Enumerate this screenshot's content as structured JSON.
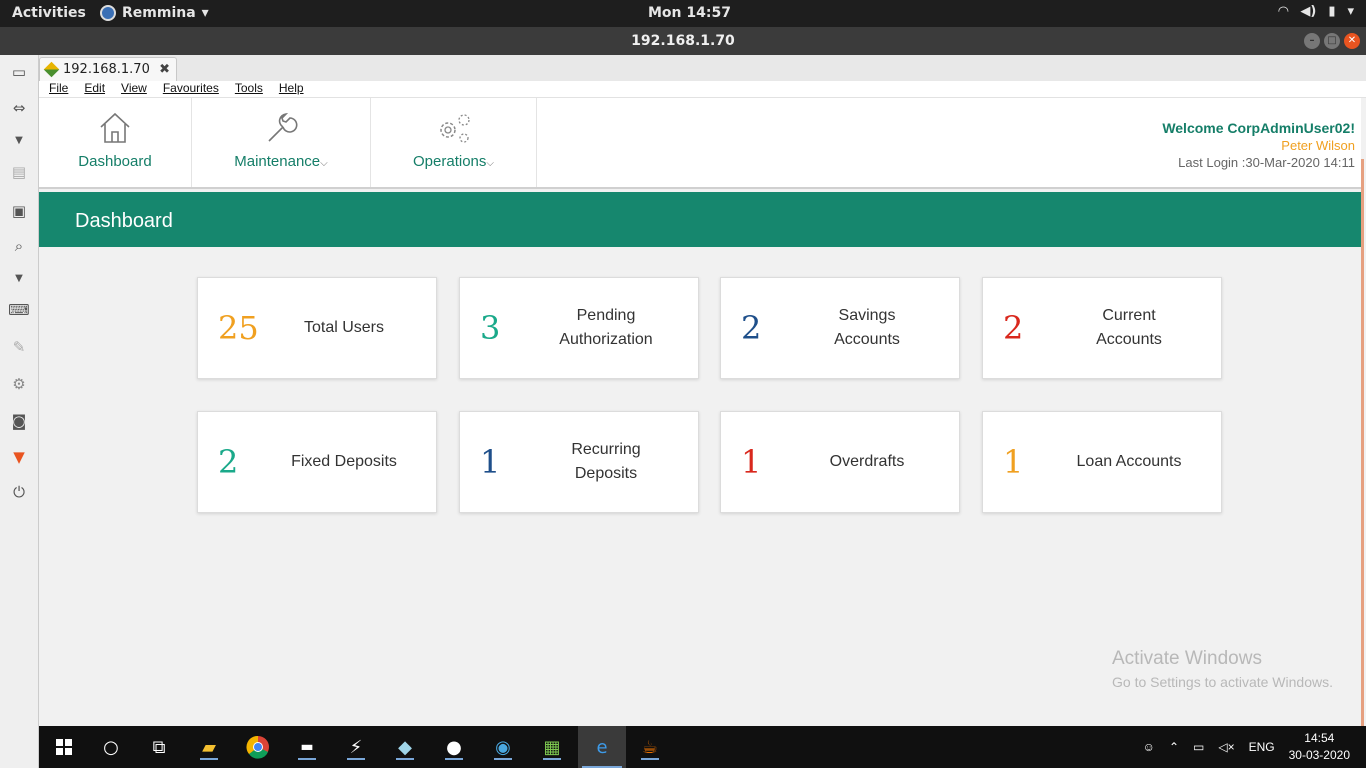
{
  "gnome": {
    "activities": "Activities",
    "app_name": "Remmina",
    "clock": "Mon 14:57"
  },
  "window": {
    "title": "192.168.1.70"
  },
  "remmina": {
    "tab_label": "192.168.1.70"
  },
  "menubar": {
    "items": [
      "File",
      "Edit",
      "View",
      "Favourites",
      "Tools",
      "Help"
    ]
  },
  "nav": {
    "dashboard": "Dashboard",
    "maintenance": "Maintenance",
    "operations": "Operations"
  },
  "user": {
    "welcome": "Welcome CorpAdminUser02!",
    "name": "Peter Wilson",
    "last_login": "Last Login :30-Mar-2020 14:11"
  },
  "page_title": "Dashboard",
  "colors": {
    "brand": "#16876e",
    "orange": "#f0a020",
    "teal": "#1aa98a",
    "navy": "#1e4f8a",
    "red": "#d9281d"
  },
  "cards": [
    {
      "value": "25",
      "label": "Total Users",
      "color": "#f0a020"
    },
    {
      "value": "3",
      "label": "Pending\nAuthorization",
      "color": "#1aa98a"
    },
    {
      "value": "2",
      "label": "Savings\nAccounts",
      "color": "#1e4f8a"
    },
    {
      "value": "2",
      "label": "Current\nAccounts",
      "color": "#d9281d"
    },
    {
      "value": "2",
      "label": "Fixed Deposits",
      "color": "#1aa98a"
    },
    {
      "value": "1",
      "label": "Recurring\nDeposits",
      "color": "#1e4f8a"
    },
    {
      "value": "1",
      "label": "Overdrafts",
      "color": "#d9281d"
    },
    {
      "value": "1",
      "label": "Loan Accounts",
      "color": "#f0a020"
    }
  ],
  "watermark": {
    "line1": "Activate Windows",
    "line2": "Go to Settings to activate Windows."
  },
  "taskbar": {
    "language": "ENG",
    "time": "14:54",
    "date": "30-03-2020"
  }
}
